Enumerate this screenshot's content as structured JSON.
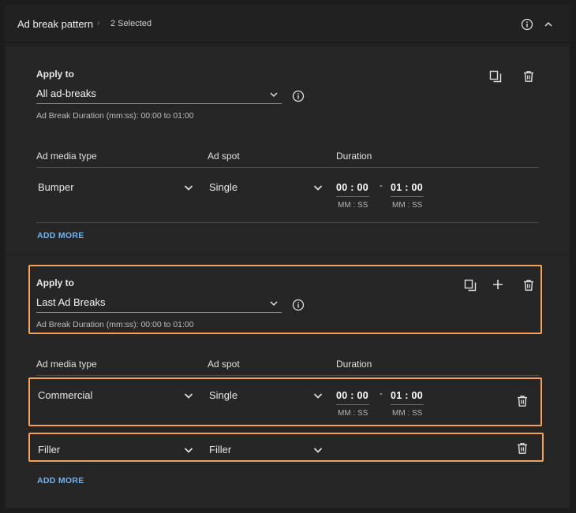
{
  "header": {
    "title": "Ad break pattern",
    "separator": "›",
    "selected_count": "2 Selected"
  },
  "sections": [
    {
      "apply_to_label": "Apply to",
      "apply_to_value": "All ad-breaks",
      "duration_hint": "Ad Break Duration (mm:ss): 00:00 to 01:00",
      "columns": [
        "Ad media type",
        "Ad spot",
        "Duration"
      ],
      "rows": [
        {
          "media_type": "Bumper",
          "ad_spot": "Single",
          "start": "00 : 00",
          "end": "01 : 00",
          "unit": "MM : SS"
        }
      ],
      "add_more": "ADD MORE"
    },
    {
      "apply_to_label": "Apply to",
      "apply_to_value": "Last Ad Breaks",
      "duration_hint": "Ad Break Duration (mm:ss): 00:00 to 01:00",
      "columns": [
        "Ad media type",
        "Ad spot",
        "Duration"
      ],
      "rows": [
        {
          "media_type": "Commercial",
          "ad_spot": "Single",
          "start": "00 : 00",
          "end": "01 : 00",
          "unit": "MM : SS"
        },
        {
          "media_type": "Filler",
          "ad_spot": "Filler"
        }
      ],
      "add_more": "ADD MORE"
    }
  ],
  "range_dash": "-",
  "colors": {
    "background": "#1c1c1c",
    "section": "#262626",
    "link": "#6fb3f2",
    "highlight": "#f5a35a"
  }
}
